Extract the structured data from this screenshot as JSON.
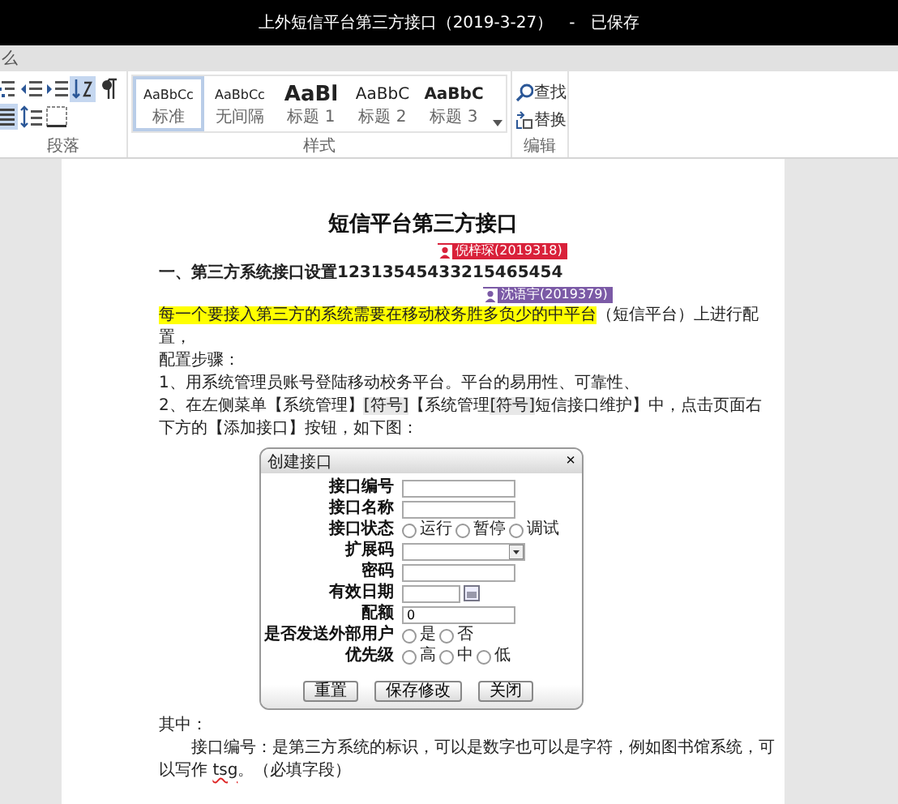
{
  "window": {
    "title": "上外短信平台第三方接口（2019-3-27）",
    "separator": "-",
    "save_state": "已保存"
  },
  "tell_me": {
    "text": "么"
  },
  "ribbon": {
    "paragraph": {
      "label": "段落",
      "tools": [
        {
          "kind": "list-levels",
          "selected": false
        },
        {
          "kind": "indent-less",
          "selected": false
        },
        {
          "kind": "indent-more",
          "selected": false
        },
        {
          "kind": "sort",
          "selected": true
        },
        {
          "kind": "marks",
          "selected": false
        },
        {
          "kind": "justify",
          "selected": true
        },
        {
          "kind": "spacing",
          "selected": false
        },
        {
          "kind": "borders",
          "selected": false
        }
      ]
    },
    "styles": {
      "label": "样式",
      "items": [
        {
          "sample": "AaBbCc",
          "name": "标准",
          "kind": "normal",
          "selected": true
        },
        {
          "sample": "AaBbCc",
          "name": "无间隔",
          "kind": "normal",
          "selected": false
        },
        {
          "sample": "AaBl",
          "name": "标题 1",
          "kind": "h1",
          "selected": false
        },
        {
          "sample": "AaBbC",
          "name": "标题 2",
          "kind": "h2",
          "selected": false
        },
        {
          "sample": "AaBbC",
          "name": "标题 3",
          "kind": "h3",
          "selected": false
        }
      ]
    },
    "editing": {
      "label": "编辑",
      "items": [
        {
          "label": "查找",
          "kind": "find"
        },
        {
          "label": "替换",
          "kind": "replace"
        }
      ]
    }
  },
  "document": {
    "heading": "短信平台第三方接口",
    "paragraphs": [
      {
        "kind": "bold",
        "segments": [
          {
            "text": "一、第三方系统接口设置1231354543321546545​4",
            "kind": "plain"
          }
        ]
      },
      {
        "kind": "plain",
        "segments": [
          {
            "text": "每一个要接入第三方的系统需要在移动校务胜多负少的中平台",
            "kind": "highlight"
          },
          {
            "text": "（短信平台）上进行配置，",
            "kind": "plain"
          }
        ]
      },
      {
        "kind": "plain",
        "segments": [
          {
            "text": "配置步骤：",
            "kind": "plain"
          }
        ]
      },
      {
        "kind": "plain",
        "segments": [
          {
            "text": "1、用系统管理员账号登陆移动校务平台。平台的易用性、可靠性、",
            "kind": "plain"
          }
        ]
      },
      {
        "kind": "plain",
        "segments": [
          {
            "text": "2、在左侧菜单【系统管理】",
            "kind": "plain"
          },
          {
            "text": "[符号]",
            "kind": "field"
          },
          {
            "text": "【系统管理",
            "kind": "plain"
          },
          {
            "text": "[符号]",
            "kind": "field"
          },
          {
            "text": "短信接口维护】中，点击页面右下方的【添加接口】按钮，如下图：",
            "kind": "plain"
          }
        ]
      }
    ],
    "comments": [
      {
        "author": "倪梓琛(2019318)",
        "color": "#d9213a"
      },
      {
        "author": "沈语宇(2019379)",
        "color": "#7b5aa6"
      }
    ],
    "dialog": {
      "title": "创建接口",
      "close": "×",
      "fields": [
        {
          "label": "接口编号",
          "kind": "text"
        },
        {
          "label": "接口名称",
          "kind": "text"
        },
        {
          "label": "接口状态",
          "kind": "radio",
          "options": [
            {
              "label": "运行",
              "selected": false
            },
            {
              "label": "暂停",
              "selected": false
            },
            {
              "label": "调试",
              "selected": false
            }
          ]
        },
        {
          "label": "扩展码",
          "kind": "select"
        },
        {
          "label": "密码",
          "kind": "text"
        },
        {
          "label": "有效日期",
          "kind": "date"
        },
        {
          "label": "配额",
          "kind": "text",
          "value": "0"
        },
        {
          "label": "是否发送外部用户",
          "kind": "radio",
          "options": [
            {
              "label": "是",
              "selected": false
            },
            {
              "label": "否",
              "selected": false
            }
          ]
        },
        {
          "label": "优先级",
          "kind": "radio",
          "options": [
            {
              "label": "高",
              "selected": false
            },
            {
              "label": "中",
              "selected": false
            },
            {
              "label": "低",
              "selected": false
            }
          ]
        }
      ],
      "buttons": [
        "重置",
        "保存修改",
        "关闭"
      ]
    },
    "after": [
      {
        "kind": "plain",
        "segments": [
          {
            "text": "其中：",
            "kind": "plain"
          }
        ]
      },
      {
        "kind": "indent",
        "segments": [
          {
            "text": "接口编号：是第三方系统的标识，可以是数字也可以是字符，例如图书馆系统，可以写作 ",
            "kind": "plain"
          },
          {
            "text": "tsg",
            "kind": "spell"
          },
          {
            "text": "。（必填字段）",
            "kind": "plain"
          }
        ]
      }
    ]
  }
}
